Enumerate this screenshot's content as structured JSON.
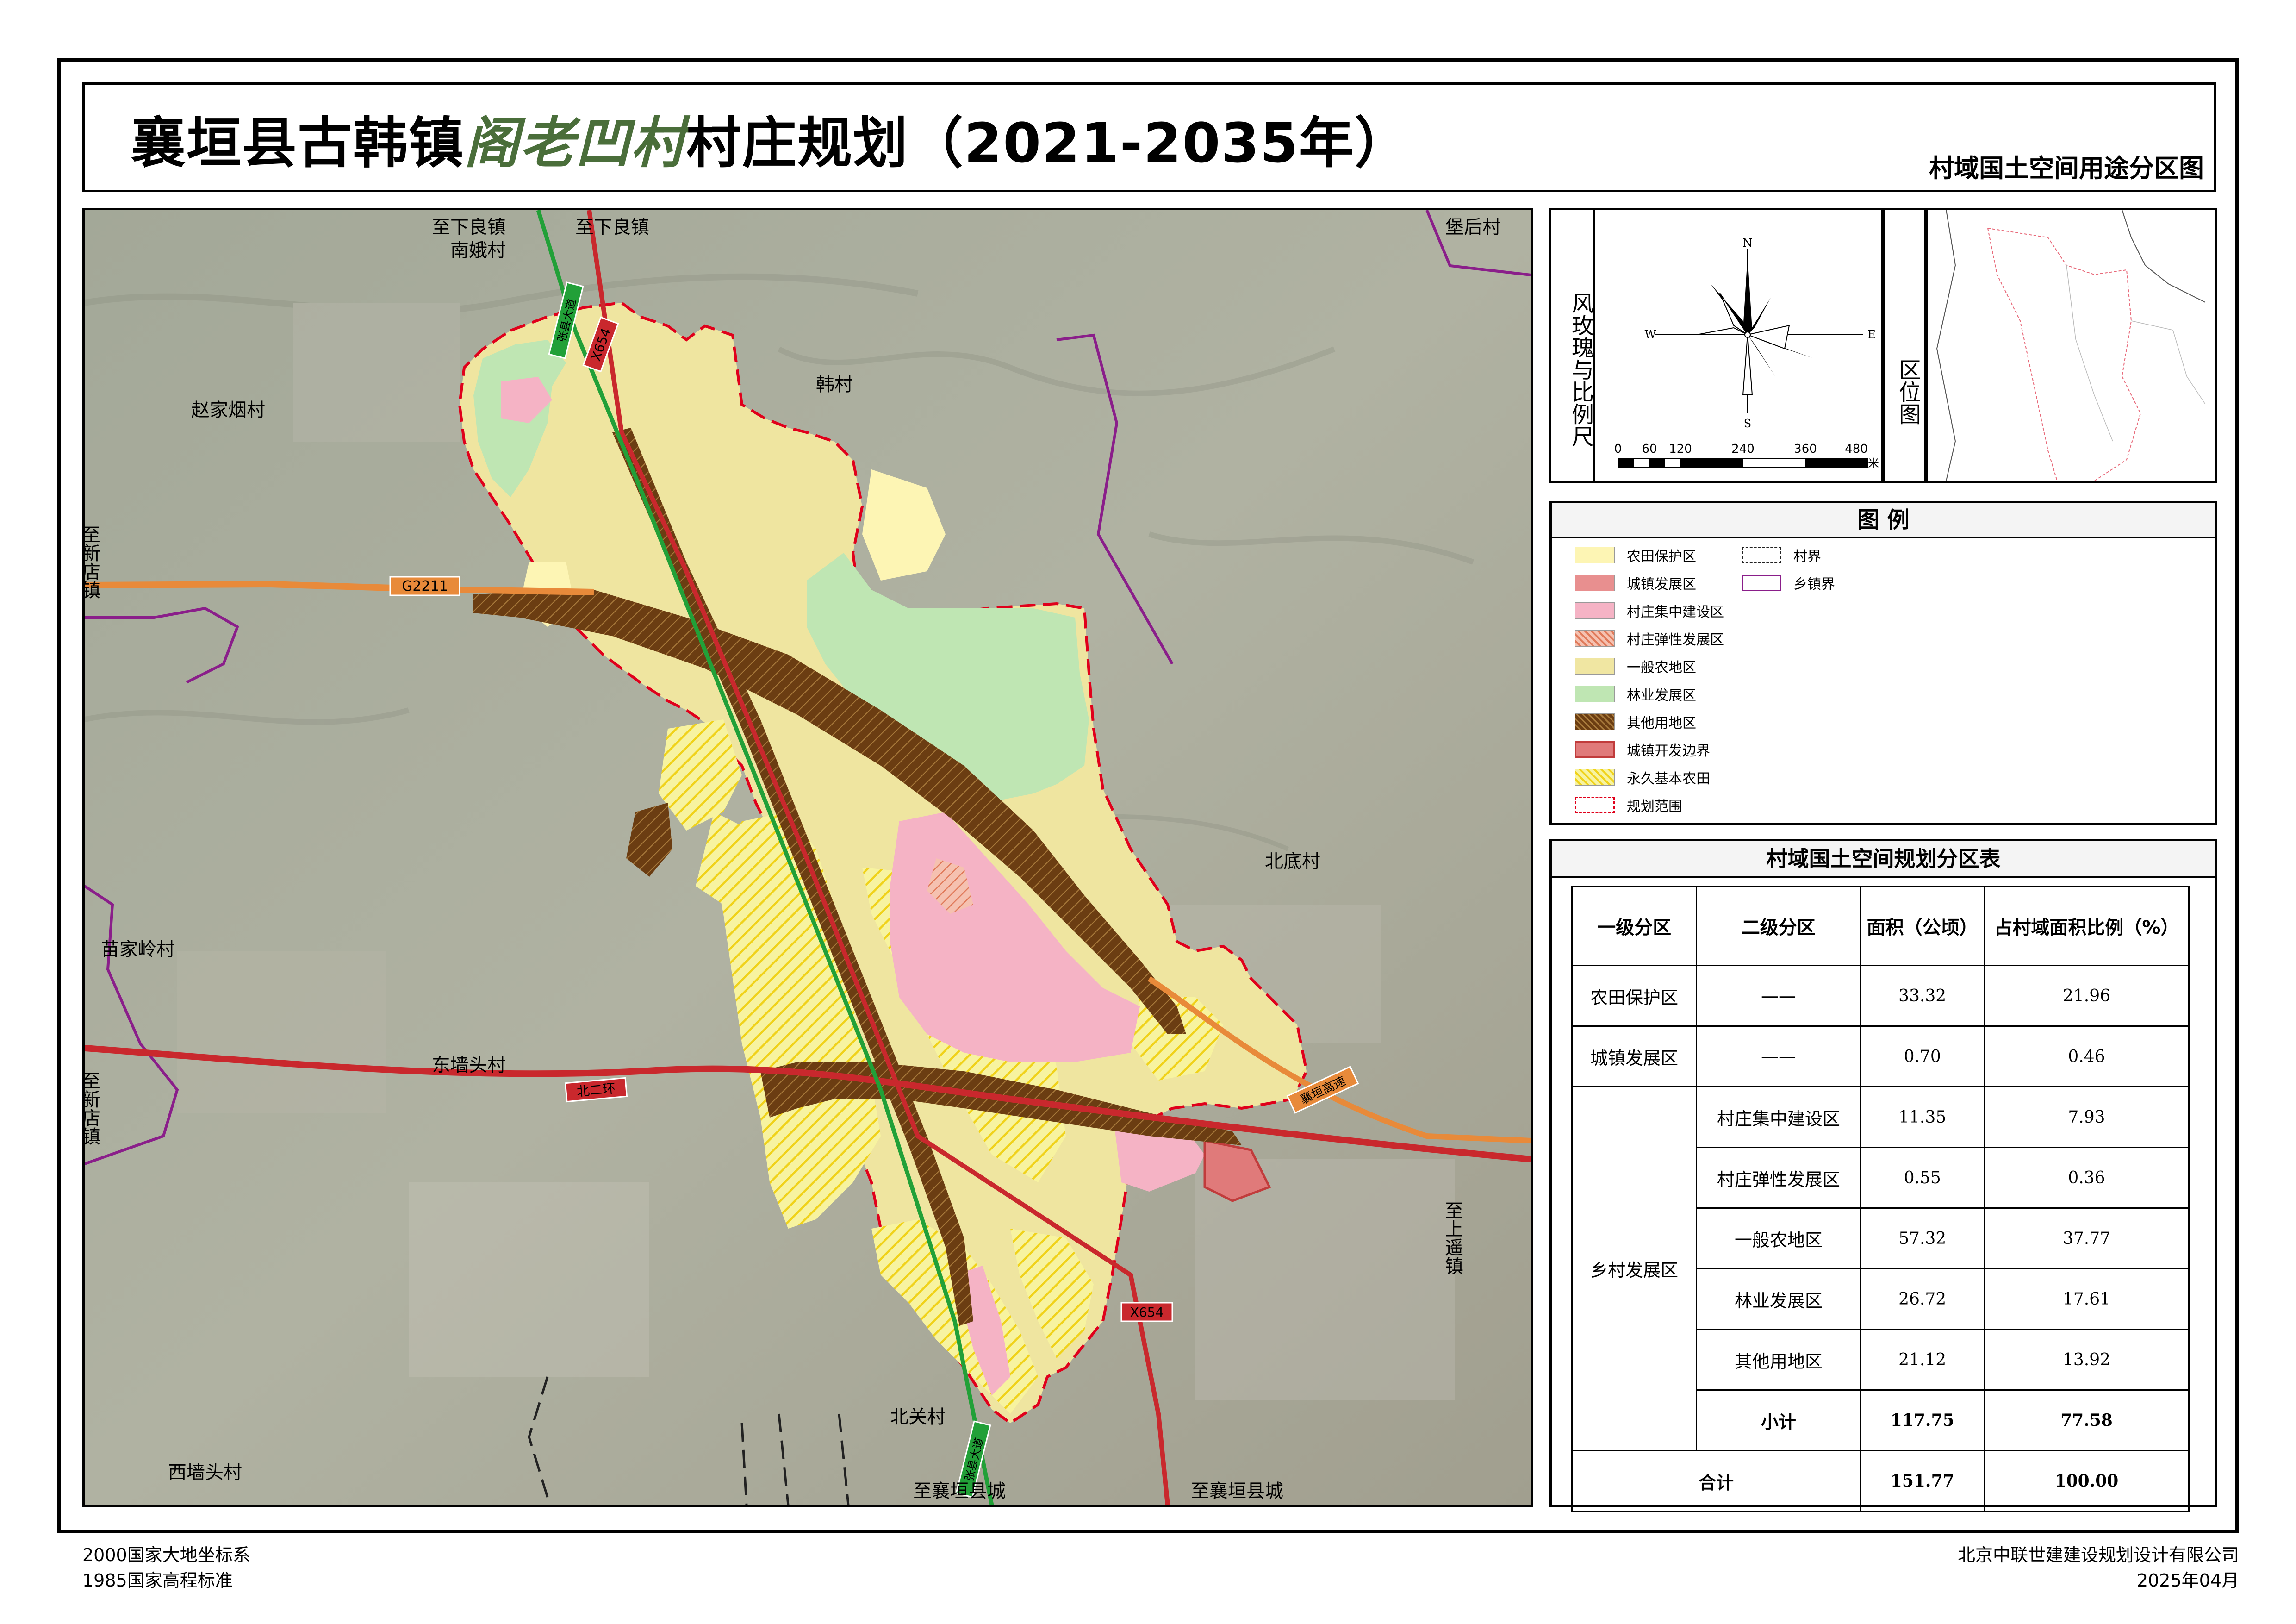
{
  "title": {
    "prefix": "襄垣县古韩镇",
    "village": "阁老凹村",
    "suffix": "村庄规划（2021-2035年）",
    "subtitle": "村域国土空间用途分区图"
  },
  "map_labels": {
    "to_xialiang_1": "至下良镇",
    "to_xialiang_2": "至下良镇",
    "nane_village": "南娥村",
    "baohou_village": "堡后村",
    "hancun": "韩村",
    "zhaojiayan_village": "赵家烟村",
    "to_xindian_top": "至新店镇",
    "to_xindian_bottom": "至新店镇",
    "miaojialing_village": "苗家岭村",
    "dongqiangtou_village": "东墙头村",
    "beidi_village": "北底村",
    "to_shangyao": "至上遥镇",
    "xiqiangtou_village": "西墙头村",
    "beiguan_village": "北关村",
    "to_xiangyuan_1": "至襄垣县城",
    "to_xiangyuan_2": "至襄垣县城",
    "road_g2211": "G2211",
    "road_x654_top": "X654",
    "road_x654_bottom": "X654",
    "road_beierhuan": "北二环",
    "road_zhangxian_top": "张县大道",
    "road_zhangxian_bottom": "张县大道",
    "road_xiangyuan_expwy": "襄垣高速"
  },
  "wind_rose": {
    "label": "风玫瑰与比例尺",
    "north": "N",
    "south": "S",
    "east": "E",
    "west": "W",
    "scale_ticks": [
      "0",
      "60",
      "120",
      "240",
      "360",
      "480"
    ],
    "scale_unit": "米"
  },
  "location_map": {
    "label": "区位图"
  },
  "legend": {
    "title": "图   例",
    "items": [
      {
        "label": "农田保护区",
        "color": "#fdf5b4",
        "style": "fill"
      },
      {
        "label": "城镇发展区",
        "color": "#e88f8f",
        "style": "fill"
      },
      {
        "label": "村庄集中建设区",
        "color": "#f5b3c5",
        "style": "fill"
      },
      {
        "label": "村庄弹性发展区",
        "color": "#f3a98d",
        "style": "hatch"
      },
      {
        "label": "一般农地区",
        "color": "#f0e6a2",
        "style": "fill"
      },
      {
        "label": "林业发展区",
        "color": "#bfe6b3",
        "style": "fill"
      },
      {
        "label": "其他用地区",
        "color": "#7a4a1b",
        "style": "hatch-dark"
      },
      {
        "label": "城镇开发边界",
        "color": "#e07a7a",
        "style": "border"
      },
      {
        "label": "永久基本农田",
        "color": "#f5f08a",
        "style": "hatch-yellow"
      },
      {
        "label": "规划范围",
        "color": "#e0001b",
        "style": "dashed"
      }
    ],
    "right_items": [
      {
        "label": "村界",
        "style": "village-boundary"
      },
      {
        "label": "乡镇界",
        "style": "town-boundary"
      }
    ]
  },
  "zone_table": {
    "title": "村域国土空间规划分区表",
    "headers": [
      "一级分区",
      "二级分区",
      "面积（公顷）",
      "占村域面积比例（%）"
    ],
    "rows": [
      {
        "level1": "农田保护区",
        "level2": "——",
        "area": "33.32",
        "ratio": "21.96"
      },
      {
        "level1": "城镇发展区",
        "level2": "——",
        "area": "0.70",
        "ratio": "0.46"
      }
    ],
    "rural_group": "乡村发展区",
    "rural_rows": [
      {
        "level2": "村庄集中建设区",
        "area": "11.35",
        "ratio": "7.93"
      },
      {
        "level2": "村庄弹性发展区",
        "area": "0.55",
        "ratio": "0.36"
      },
      {
        "level2": "一般农地区",
        "area": "57.32",
        "ratio": "37.77"
      },
      {
        "level2": "林业发展区",
        "area": "26.72",
        "ratio": "17.61"
      },
      {
        "level2": "其他用地区",
        "area": "21.12",
        "ratio": "13.92"
      }
    ],
    "subtotal": {
      "label": "小计",
      "area": "117.75",
      "ratio": "77.58"
    },
    "total": {
      "label": "合计",
      "area": "151.77",
      "ratio": "100.00"
    }
  },
  "footer": {
    "coord_system": "2000国家大地坐标系",
    "elevation_system": "1985国家高程标准",
    "company": "北京中联世建建设规划设计有限公司",
    "date": "2025年04月"
  }
}
